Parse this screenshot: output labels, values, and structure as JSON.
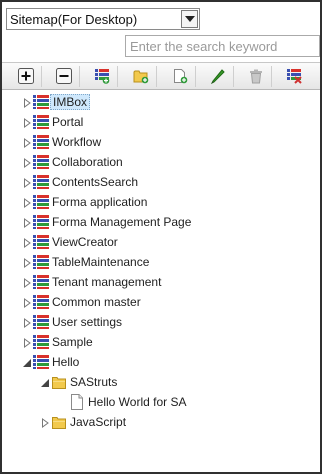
{
  "selector": {
    "value": "Sitemap(For Desktop)"
  },
  "search": {
    "placeholder": "Enter the search keyword",
    "value": ""
  },
  "toolbar": {
    "buttons": [
      {
        "name": "expand-all-button",
        "icon": "plus-icon"
      },
      {
        "name": "collapse-all-button",
        "icon": "minus-icon"
      },
      {
        "name": "add-menu-button",
        "icon": "menu-list-add-icon"
      },
      {
        "name": "add-folder-button",
        "icon": "folder-add-icon"
      },
      {
        "name": "add-page-button",
        "icon": "page-add-icon"
      },
      {
        "name": "edit-button",
        "icon": "pencil-icon"
      },
      {
        "name": "delete-button",
        "icon": "trash-icon"
      },
      {
        "name": "remove-button",
        "icon": "list-remove-icon"
      }
    ]
  },
  "tree": {
    "items": [
      {
        "label": "IMBox",
        "icon": "menu-list-icon",
        "depth": 0,
        "state": "collapsed",
        "selected": true
      },
      {
        "label": "Portal",
        "icon": "menu-list-icon",
        "depth": 0,
        "state": "collapsed"
      },
      {
        "label": "Workflow",
        "icon": "menu-list-icon",
        "depth": 0,
        "state": "collapsed"
      },
      {
        "label": "Collaboration",
        "icon": "menu-list-icon",
        "depth": 0,
        "state": "collapsed"
      },
      {
        "label": "ContentsSearch",
        "icon": "menu-list-icon",
        "depth": 0,
        "state": "collapsed"
      },
      {
        "label": "Forma application",
        "icon": "menu-list-icon",
        "depth": 0,
        "state": "collapsed"
      },
      {
        "label": "Forma Management Page",
        "icon": "menu-list-icon",
        "depth": 0,
        "state": "collapsed"
      },
      {
        "label": "ViewCreator",
        "icon": "menu-list-icon",
        "depth": 0,
        "state": "collapsed"
      },
      {
        "label": "TableMaintenance",
        "icon": "menu-list-icon",
        "depth": 0,
        "state": "collapsed"
      },
      {
        "label": "Tenant management",
        "icon": "menu-list-icon",
        "depth": 0,
        "state": "collapsed"
      },
      {
        "label": "Common master",
        "icon": "menu-list-icon",
        "depth": 0,
        "state": "collapsed"
      },
      {
        "label": "User settings",
        "icon": "menu-list-icon",
        "depth": 0,
        "state": "collapsed"
      },
      {
        "label": "Sample",
        "icon": "menu-list-icon",
        "depth": 0,
        "state": "collapsed"
      },
      {
        "label": "Hello",
        "icon": "menu-list-icon",
        "depth": 0,
        "state": "expanded"
      },
      {
        "label": "SAStruts",
        "icon": "folder-icon",
        "depth": 1,
        "state": "expanded"
      },
      {
        "label": "Hello World for SA",
        "icon": "page-icon",
        "depth": 2,
        "state": "leaf"
      },
      {
        "label": "JavaScript",
        "icon": "folder-icon",
        "depth": 1,
        "state": "collapsed"
      }
    ]
  },
  "colors": {
    "selection": "#cfe8fc",
    "frame": "#303030",
    "folder": "#f2c94c",
    "pencil": "#3a9a2a",
    "delete_red": "#d03030"
  }
}
